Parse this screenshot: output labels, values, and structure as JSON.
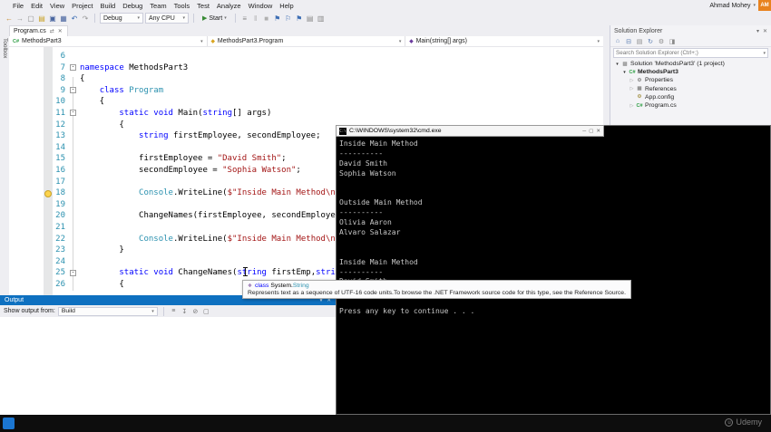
{
  "menu": {
    "items": [
      "File",
      "Edit",
      "View",
      "Project",
      "Build",
      "Debug",
      "Team",
      "Tools",
      "Test",
      "Analyze",
      "Window",
      "Help"
    ]
  },
  "header": {
    "user_name": "Ahmad Mohey",
    "avatar": "AM"
  },
  "toolbar": {
    "left_icons": [
      {
        "name": "navigate-backward-icon",
        "glyph": "←",
        "color": "#C98B2D"
      },
      {
        "name": "navigate-forward-icon",
        "glyph": "→",
        "color": "#9A9A9A"
      },
      {
        "name": "new-project-icon",
        "glyph": "▢",
        "color": "#8A8A8A"
      },
      {
        "name": "open-file-icon",
        "glyph": "▤",
        "color": "#C9A227"
      },
      {
        "name": "save-icon",
        "glyph": "▣",
        "color": "#4A66A0"
      },
      {
        "name": "save-all-icon",
        "glyph": "▦",
        "color": "#4A66A0"
      },
      {
        "name": "undo-icon",
        "glyph": "↶",
        "color": "#3D6EB4"
      },
      {
        "name": "redo-icon",
        "glyph": "↷",
        "color": "#9A9A9A"
      }
    ],
    "configuration": "Debug",
    "platform": "Any CPU",
    "start_label": "Start",
    "right_icons": [
      {
        "name": "attach-icon",
        "glyph": "≡",
        "color": "#8A8A8A"
      },
      {
        "name": "break-all-icon",
        "glyph": "‖",
        "color": "#B0B0B0"
      },
      {
        "name": "stop-icon",
        "glyph": "■",
        "color": "#B0B0B0"
      },
      {
        "name": "bookmark-icon",
        "glyph": "⚑",
        "color": "#3D6EB4"
      },
      {
        "name": "prev-bookmark-icon",
        "glyph": "⚐",
        "color": "#3D6EB4"
      },
      {
        "name": "next-bookmark-icon",
        "glyph": "⚑",
        "color": "#3D6EB4"
      },
      {
        "name": "comment-icon",
        "glyph": "▤",
        "color": "#8A8A8A"
      },
      {
        "name": "uncomment-icon",
        "glyph": "▥",
        "color": "#8A8A8A"
      }
    ]
  },
  "left_rail": {
    "toolbox_label": "Toolbox"
  },
  "editor": {
    "tab": {
      "title": "Program.cs",
      "icons": [
        {
          "name": "float-tab-icon",
          "glyph": "⇄",
          "color": "#717171"
        },
        {
          "name": "close-tab-icon",
          "glyph": "✕",
          "color": "#717171"
        }
      ]
    },
    "breadcrumbs": {
      "project": {
        "icon": "C#",
        "icon_color": "#2E9E44",
        "label": "MethodsPart3"
      },
      "type": {
        "icon": "◆",
        "icon_color": "#D9A521",
        "label": "MethodsPart3.Program"
      },
      "member": {
        "icon": "◆",
        "icon_color": "#6A3A9E",
        "label": "Main(string[] args)"
      }
    },
    "lines": [
      {
        "n": "6",
        "segs": []
      },
      {
        "n": "7",
        "fold": true,
        "segs": [
          {
            "c": "kw",
            "t": "namespace"
          },
          {
            "c": "pl",
            "t": " MethodsPart3"
          }
        ]
      },
      {
        "n": "8",
        "segs": [
          {
            "c": "pl",
            "t": "{"
          }
        ]
      },
      {
        "n": "9",
        "fold": true,
        "segs": [
          {
            "c": "pl",
            "t": "    "
          },
          {
            "c": "kw",
            "t": "class"
          },
          {
            "c": "pl",
            "t": " "
          },
          {
            "c": "ty",
            "t": "Program"
          }
        ]
      },
      {
        "n": "10",
        "segs": [
          {
            "c": "pl",
            "t": "    {"
          }
        ]
      },
      {
        "n": "11",
        "fold": true,
        "segs": [
          {
            "c": "pl",
            "t": "        "
          },
          {
            "c": "kw",
            "t": "static"
          },
          {
            "c": "pl",
            "t": " "
          },
          {
            "c": "kw",
            "t": "void"
          },
          {
            "c": "pl",
            "t": " Main("
          },
          {
            "c": "kw",
            "t": "string"
          },
          {
            "c": "pl",
            "t": "[] args)"
          }
        ]
      },
      {
        "n": "12",
        "segs": [
          {
            "c": "pl",
            "t": "        {"
          }
        ]
      },
      {
        "n": "13",
        "segs": [
          {
            "c": "pl",
            "t": "            "
          },
          {
            "c": "kw",
            "t": "string"
          },
          {
            "c": "pl",
            "t": " firstEmployee, secondEmployee;"
          }
        ]
      },
      {
        "n": "14",
        "segs": []
      },
      {
        "n": "15",
        "segs": [
          {
            "c": "pl",
            "t": "            firstEmployee = "
          },
          {
            "c": "str",
            "t": "\"David Smith\""
          },
          {
            "c": "pl",
            "t": ";"
          }
        ]
      },
      {
        "n": "16",
        "segs": [
          {
            "c": "pl",
            "t": "            secondEmployee = "
          },
          {
            "c": "str",
            "t": "\"Sophia Watson\""
          },
          {
            "c": "pl",
            "t": ";"
          }
        ]
      },
      {
        "n": "17",
        "segs": []
      },
      {
        "n": "18",
        "bulb": true,
        "segs": [
          {
            "c": "pl",
            "t": "            "
          },
          {
            "c": "ty",
            "t": "Console"
          },
          {
            "c": "pl",
            "t": ".WriteLine("
          },
          {
            "c": "str",
            "t": "$\"Inside Main Method\\n"
          }
        ]
      },
      {
        "n": "19",
        "segs": []
      },
      {
        "n": "20",
        "segs": [
          {
            "c": "pl",
            "t": "            ChangeNames(firstEmployee, secondEmploye"
          }
        ]
      },
      {
        "n": "21",
        "segs": []
      },
      {
        "n": "22",
        "segs": [
          {
            "c": "pl",
            "t": "            "
          },
          {
            "c": "ty",
            "t": "Console"
          },
          {
            "c": "pl",
            "t": ".WriteLine("
          },
          {
            "c": "str",
            "t": "$\"Inside Main Method\\n"
          }
        ]
      },
      {
        "n": "23",
        "segs": [
          {
            "c": "pl",
            "t": "        }"
          }
        ]
      },
      {
        "n": "24",
        "segs": []
      },
      {
        "n": "25",
        "fold": true,
        "segs": [
          {
            "c": "pl",
            "t": "        "
          },
          {
            "c": "kw",
            "t": "static"
          },
          {
            "c": "pl",
            "t": " "
          },
          {
            "c": "kw",
            "t": "void"
          },
          {
            "c": "pl",
            "t": " ChangeNames("
          },
          {
            "c": "kw",
            "t": "string"
          },
          {
            "c": "pl",
            "t": " firstEmp,"
          },
          {
            "c": "kw",
            "t": "stri"
          }
        ]
      },
      {
        "n": "26",
        "segs": [
          {
            "c": "pl",
            "t": "        {"
          }
        ]
      }
    ]
  },
  "solution_explorer": {
    "title": "Solution Explorer",
    "search_placeholder": "Search Solution Explorer (Ctrl+;)",
    "toolbar_icons": [
      {
        "name": "home-icon",
        "glyph": "⌂",
        "color": "#5B7DB1"
      },
      {
        "name": "collapse-all-icon",
        "glyph": "⊟",
        "color": "#5B7DB1"
      },
      {
        "name": "show-all-files-icon",
        "glyph": "▤",
        "color": "#8A8A8A"
      },
      {
        "name": "refresh-icon",
        "glyph": "↻",
        "color": "#5B7DB1"
      },
      {
        "name": "properties-icon",
        "glyph": "⚙",
        "color": "#8A8A8A"
      },
      {
        "name": "preview-icon",
        "glyph": "◨",
        "color": "#8A8A8A"
      }
    ],
    "tree": [
      {
        "id": "solution",
        "indent": 0,
        "exp": "open",
        "icon": {
          "name": "solution-icon",
          "glyph": "▨",
          "color": "#8C8C8C"
        },
        "label": "Solution 'MethodsPart3' (1 project)"
      },
      {
        "id": "project-methodspart3",
        "indent": 1,
        "exp": "open",
        "icon": {
          "name": "csharp-project-icon",
          "glyph": "C#",
          "color": "#2E9E44"
        },
        "label": "MethodsPart3",
        "bold": true
      },
      {
        "id": "properties",
        "indent": 2,
        "exp": "closed",
        "icon": {
          "name": "wrench-icon",
          "glyph": "⚙",
          "color": "#8C8C8C"
        },
        "label": "Properties"
      },
      {
        "id": "references",
        "indent": 2,
        "exp": "closed",
        "icon": {
          "name": "references-icon",
          "glyph": "▦",
          "color": "#8C8C8C"
        },
        "label": "References"
      },
      {
        "id": "app-config",
        "indent": 2,
        "exp": null,
        "icon": {
          "name": "config-file-icon",
          "glyph": "⚙",
          "color": "#B0A060"
        },
        "label": "App.config"
      },
      {
        "id": "program-cs",
        "indent": 2,
        "exp": "closed",
        "icon": {
          "name": "csharp-file-icon",
          "glyph": "C#",
          "color": "#2E9E44"
        },
        "label": "Program.cs"
      }
    ]
  },
  "console": {
    "title": "C:\\WINDOWS\\system32\\cmd.exe",
    "lines": [
      "Inside Main Method",
      "----------",
      "David Smith",
      "Sophia Watson",
      "",
      "",
      "Outside Main Method",
      "----------",
      "Olivia Aaron",
      "Alvaro Salazar",
      "",
      "",
      "Inside Main Method",
      "----------",
      "David Smith",
      "Sophia Watson",
      "",
      "Press any key to continue . . ."
    ]
  },
  "tooltip": {
    "line1_keyword": "class",
    "line1_namespace": " System.",
    "line1_type": "String",
    "line2": "Represents text as a sequence of UTF-16 code units.To browse the .NET Framework source code for this type, see the Reference Source."
  },
  "output": {
    "title": "Output",
    "show_from_label": "Show output from:",
    "source": "Build",
    "icons": [
      {
        "name": "message-list-icon",
        "glyph": "≡",
        "color": "#717171"
      },
      {
        "name": "goto-message-icon",
        "glyph": "↧",
        "color": "#717171"
      },
      {
        "name": "clear-all-icon",
        "glyph": "⊘",
        "color": "#717171"
      },
      {
        "name": "word-wrap-icon",
        "glyph": "▢",
        "color": "#717171"
      }
    ]
  },
  "overlay": {
    "watermark": "Udemy"
  }
}
